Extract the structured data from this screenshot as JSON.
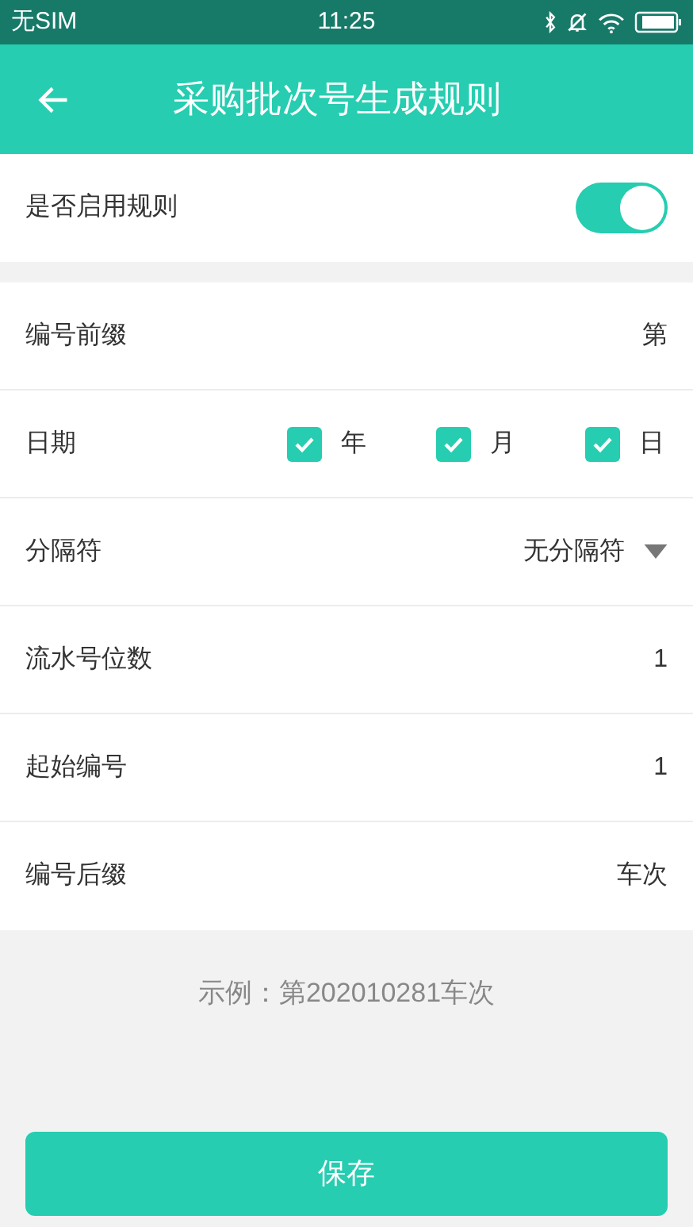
{
  "status_bar": {
    "carrier": "无SIM",
    "time": "11:25"
  },
  "header": {
    "title": "采购批次号生成规则"
  },
  "enable_rule": {
    "label": "是否启用规则",
    "on": true
  },
  "rows": [
    {
      "kind": "text",
      "label": "编号前缀",
      "value": "第"
    },
    {
      "kind": "date",
      "label": "日期",
      "options": [
        {
          "label": "年",
          "checked": true
        },
        {
          "label": "月",
          "checked": true
        },
        {
          "label": "日",
          "checked": true
        }
      ]
    },
    {
      "kind": "select",
      "label": "分隔符",
      "value": "无分隔符"
    },
    {
      "kind": "text",
      "label": "流水号位数",
      "value": "1"
    },
    {
      "kind": "text",
      "label": "起始编号",
      "value": "1"
    },
    {
      "kind": "text",
      "label": "编号后缀",
      "value": "车次"
    }
  ],
  "example": "示例：第202010281车次",
  "save_button": "保存"
}
